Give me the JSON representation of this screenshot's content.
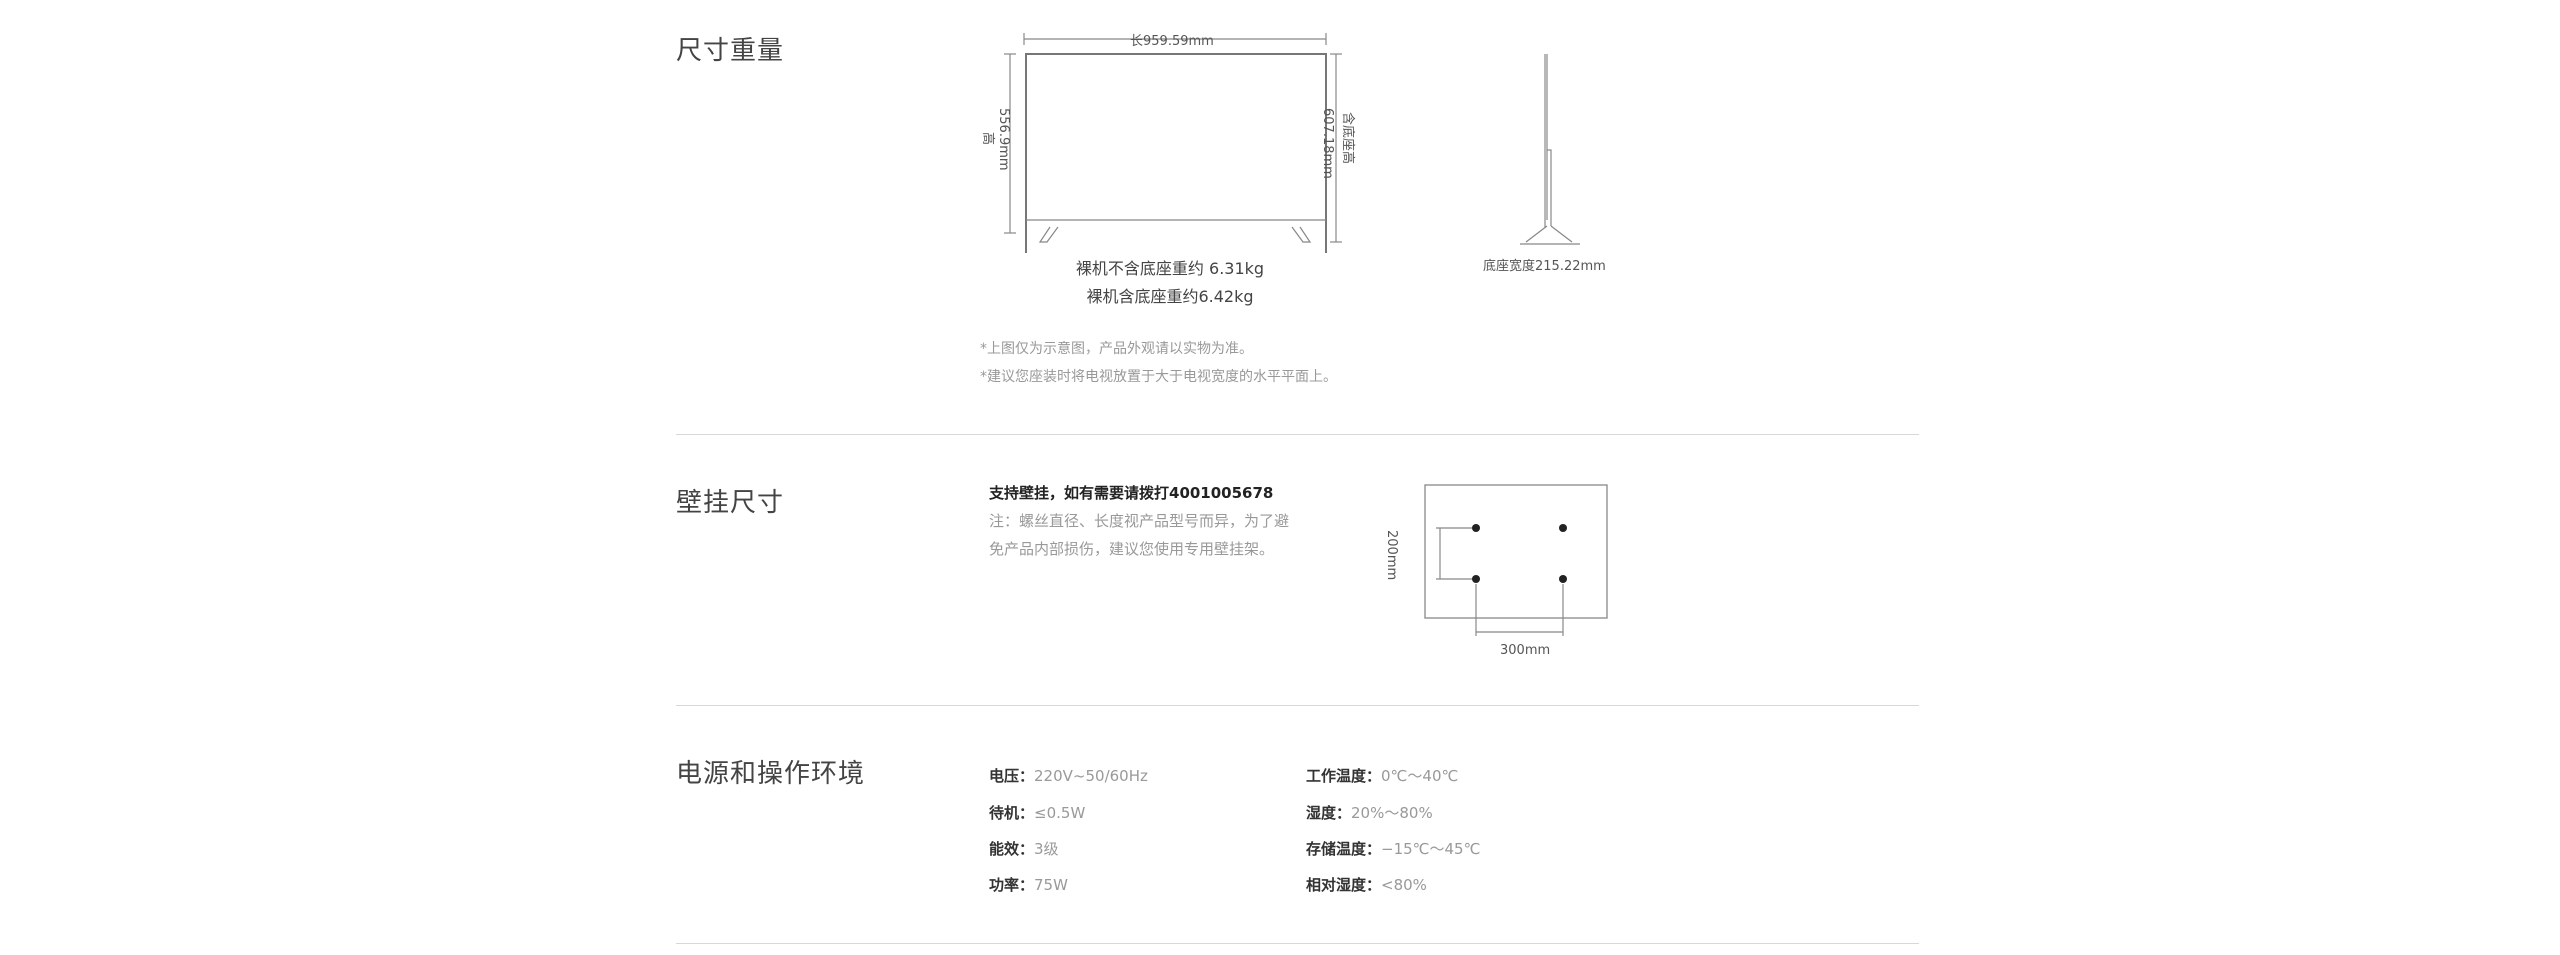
{
  "size_weight": {
    "title": "尺寸重量",
    "length_label": "长959.59mm",
    "height_label": "556.9mm",
    "height_suffix": "高",
    "height_with_stand": "607.18mm",
    "height_with_stand_suffix": "含底座高",
    "weight_without_stand": "裸机不含底座重约 6.31kg",
    "weight_with_stand": "裸机含底座重约6.42kg",
    "stand_width": "底座宽度215.22mm",
    "note_1": "*上图仅为示意图，产品外观请以实物为准。",
    "note_2": "*建议您座装时将电视放置于大于电视宽度的水平平面上。"
  },
  "wall_mount": {
    "title": "壁挂尺寸",
    "support_text": "支持壁挂，如有需要请拨打4001005678",
    "note_line_1": "注：螺丝直径、长度视产品型号而异，为了避",
    "note_line_2": "免产品内部损伤，建议您使用专用壁挂架。",
    "vertical_spacing": "200mm",
    "horizontal_spacing": "300mm"
  },
  "power_env": {
    "title": "电源和操作环境",
    "left": [
      {
        "key": "电压：",
        "value": "220V~50/60Hz"
      },
      {
        "key": "待机：",
        "value": "≤0.5W"
      },
      {
        "key": "能效：",
        "value": "3级"
      },
      {
        "key": "功率：",
        "value": "75W"
      }
    ],
    "right": [
      {
        "key": "工作温度：",
        "value": "0℃～40℃"
      },
      {
        "key": "湿度：",
        "value": "20%～80%"
      },
      {
        "key": "存储温度：",
        "value": "−15℃～45℃"
      },
      {
        "key": "相对湿度：",
        "value": "<80%"
      }
    ]
  }
}
